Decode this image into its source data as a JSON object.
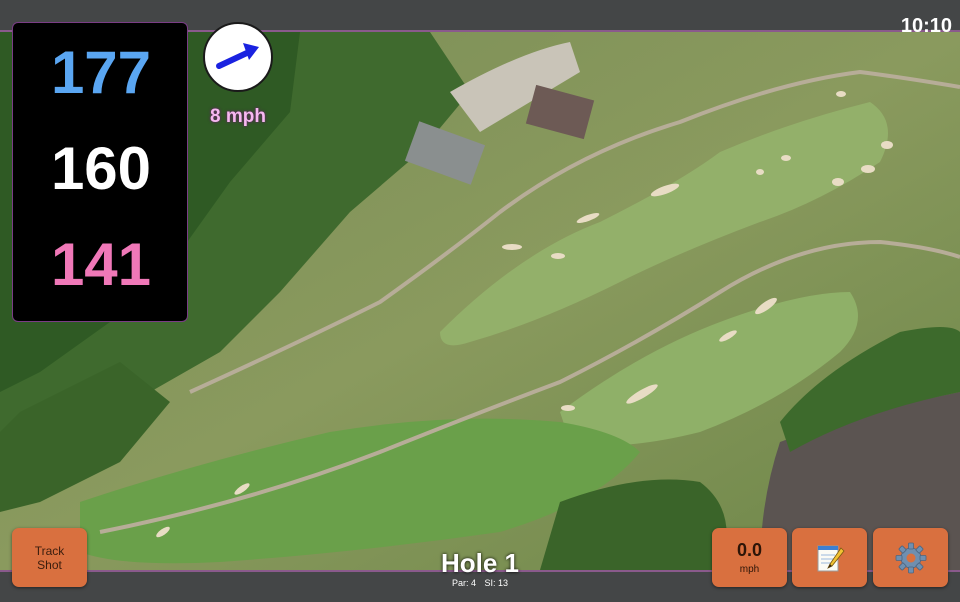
{
  "status_bar": {
    "time": "10:10"
  },
  "yardage": {
    "back": "177",
    "middle": "160",
    "front": "141"
  },
  "wind": {
    "speed": "8 mph",
    "icon": "wind-direction-arrow-icon",
    "arrow_color": "#1a22e0"
  },
  "hole": {
    "title": "Hole 1",
    "par": "Par: 4",
    "stroke_index": "SI: 13"
  },
  "buttons": {
    "track_shot": {
      "line1": "Track",
      "line2": "Shot"
    },
    "speed": {
      "value": "0.0",
      "unit": "mph"
    },
    "notes": {
      "icon": "notepad-pencil-icon"
    },
    "settings": {
      "icon": "gear-icon"
    }
  },
  "colors": {
    "back_distance": "#5aa6f2",
    "middle_distance": "#ffffff",
    "front_distance": "#f078b8",
    "button_bg": "#d9703f",
    "accent_border": "#8a5a8c"
  }
}
